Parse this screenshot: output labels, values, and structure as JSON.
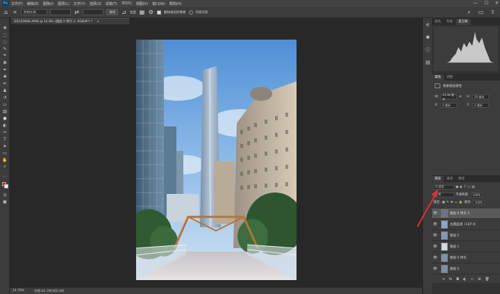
{
  "menu": {
    "logo": "Ps",
    "items": [
      "文件(F)",
      "编辑(E)",
      "图像(I)",
      "图层(L)",
      "文字(Y)",
      "选择(S)",
      "滤镜(T)",
      "3D(D)",
      "视图(V)",
      "窗口(W)",
      "帮助(H)"
    ],
    "window_controls": [
      "—",
      "☐",
      "✕"
    ]
  },
  "options": {
    "ratio": "原始比例",
    "swap": "⇄",
    "clear_label": "清除",
    "straighten": "拉直",
    "delete_pixels_label": "删除裁剪的像素",
    "content_aware_label": "内容识别"
  },
  "document": {
    "tab_title": "DSC03606.ARW @ 14.8% (图层 0 拷贝 2, RGB/8*) *",
    "close": "×"
  },
  "status": {
    "zoom": "14.76%",
    "doc_info": "文档:65.7M/365.6M"
  },
  "panels": {
    "top_tabs": [
      "颜色",
      "色板",
      "直方图"
    ],
    "active_top_tab": "直方图",
    "props_tabs": [
      "属性",
      "调整"
    ],
    "props_title": "像素图层属性",
    "props_w_label": "W:",
    "props_w_value": "13.34 厘米",
    "props_h_label": "H:",
    "props_h_value": "20 厘米",
    "props_x_label": "X:",
    "props_x_value": "0 厘米",
    "props_y_label": "Y:",
    "props_y_value": "0 厘米",
    "link_icon": "⊖",
    "layers_tabs": [
      "图层",
      "通道",
      "路径"
    ],
    "filter_kind": "Q 类型",
    "blend_mode": "正常",
    "opacity_label": "不透明度:",
    "opacity_value": "100%",
    "lock_label": "锁定:",
    "fill_label": "填充:",
    "fill_value": "100%",
    "layers": [
      {
        "name": "图层 0 拷贝 2",
        "selected": true
      },
      {
        "name": "古典蓝调（CEP 4）",
        "selected": false
      },
      {
        "name": "图层 2",
        "selected": false
      },
      {
        "name": "图层 1",
        "selected": false
      },
      {
        "name": "图层 0 拷贝",
        "selected": false
      },
      {
        "name": "图层 0",
        "selected": false
      }
    ],
    "layer_footer_icons": [
      "ɑ",
      "fx",
      "◘",
      "◐",
      "▭",
      "⊞",
      "🗑"
    ]
  },
  "colors": {
    "accent": "#31a8ff",
    "foreground_color": "#e01d1d",
    "background_color": "#ffffff",
    "annotation_arrow": "#e23030"
  }
}
